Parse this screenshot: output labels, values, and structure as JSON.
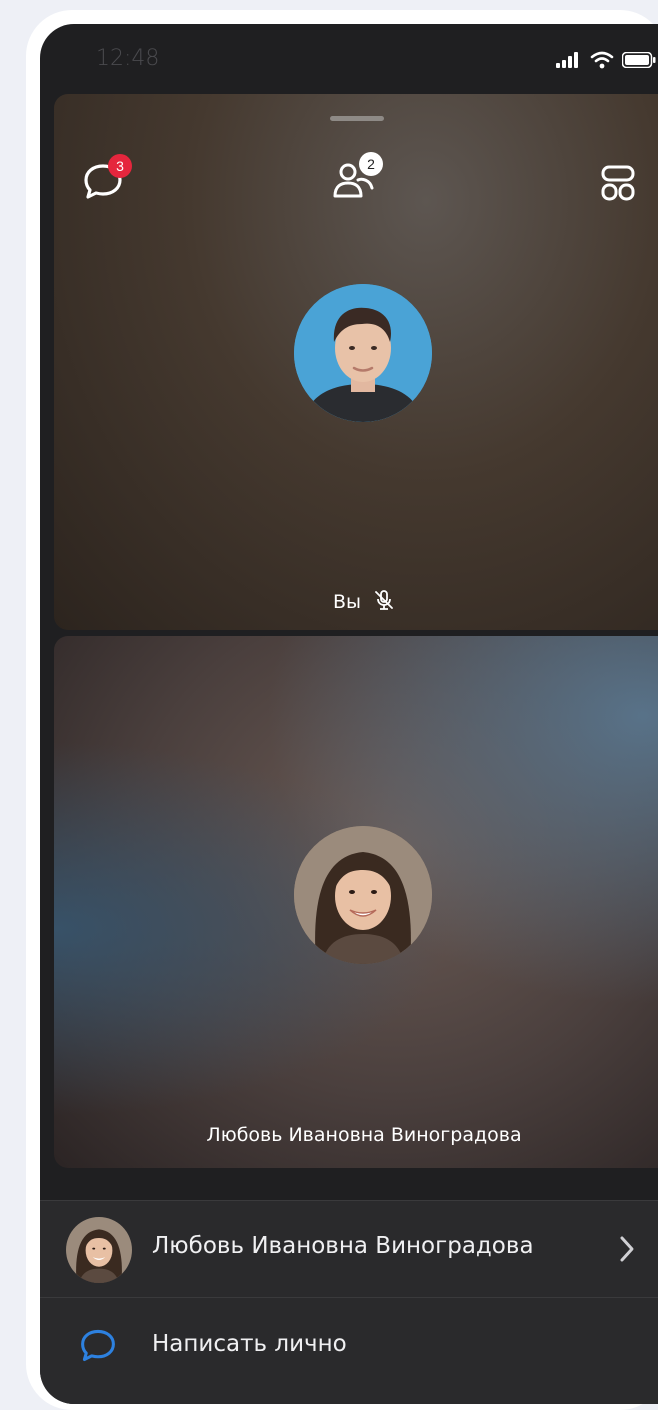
{
  "status_bar": {
    "time": "12:48"
  },
  "header": {
    "chat_badge": "3",
    "participants_badge": "2"
  },
  "tiles": [
    {
      "label": "Вы"
    },
    {
      "label": "Любовь Ивановна Виноградова"
    }
  ],
  "sheet": {
    "contact_name": "Любовь Ивановна Виноградова",
    "message_action": "Написать лично"
  },
  "colors": {
    "accent": "#2d81e0",
    "badge_red": "#e5263d",
    "background": "#1f1f21"
  }
}
